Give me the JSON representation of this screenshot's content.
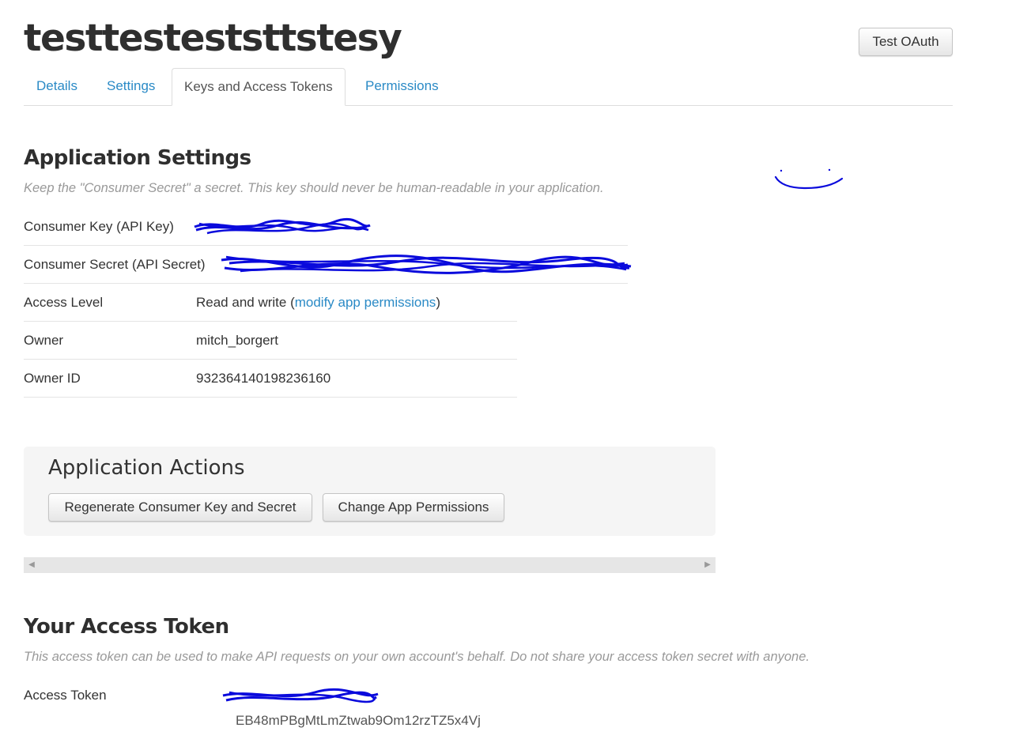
{
  "app": {
    "title": "testtesteststtstesy",
    "test_oauth_label": "Test OAuth"
  },
  "tabs": [
    {
      "label": "Details"
    },
    {
      "label": "Settings"
    },
    {
      "label": "Keys and Access Tokens",
      "active": true
    },
    {
      "label": "Permissions"
    }
  ],
  "app_settings": {
    "heading": "Application Settings",
    "note": "Keep the \"Consumer Secret\" a secret. This key should never be human-readable in your application.",
    "rows": [
      {
        "label": "Consumer Key (API Key)",
        "value": "",
        "redacted": true
      },
      {
        "label": "Consumer Secret (API Secret)",
        "value": "",
        "redacted": true
      },
      {
        "label": "Access Level",
        "value_prefix": "Read and write (",
        "link": "modify app permissions",
        "value_suffix": ")"
      },
      {
        "label": "Owner",
        "value": "mitch_borgert"
      },
      {
        "label": "Owner ID",
        "value": "932364140198236160"
      }
    ]
  },
  "actions": {
    "heading": "Application Actions",
    "regenerate_label": "Regenerate Consumer Key and Secret",
    "change_permissions_label": "Change App Permissions"
  },
  "access_token": {
    "heading": "Your Access Token",
    "note": "This access token can be used to make API requests on your own account's behalf. Do not share your access token secret with anyone.",
    "rows": [
      {
        "label": "Access Token",
        "value": "",
        "redacted": true,
        "partial_line": "EB48mPBgMtLmZtwab9Om12rzTZ5x4Vj"
      }
    ]
  },
  "colors": {
    "link": "#2a8ac6",
    "scribble": "#0a0adc",
    "heading": "#2f2f2f",
    "note": "#999999"
  }
}
